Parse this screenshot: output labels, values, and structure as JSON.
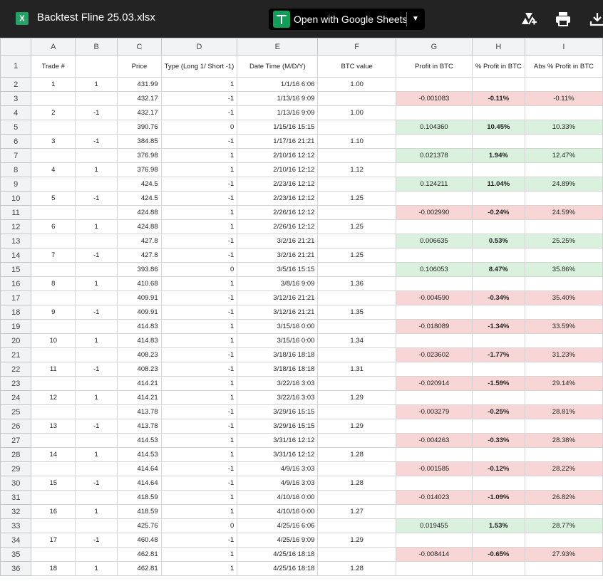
{
  "file": {
    "title": "Backtest Fline 25.03.xlsx",
    "icon_letter": "X"
  },
  "toolbar": {
    "open_label": "Open with Google Sheets",
    "icons": [
      "add-to-drive-icon",
      "print-icon",
      "download-icon"
    ]
  },
  "colors": {
    "positive": "#d9f1dd",
    "negative": "#f8d6d6",
    "topbar": "#232323"
  },
  "columns": [
    "A",
    "B",
    "C",
    "D",
    "E",
    "F",
    "G",
    "H",
    "I"
  ],
  "headers": {
    "trade": "Trade #",
    "b": "",
    "price": "Price",
    "type": "Type (Long 1/ Short -1)",
    "datetime": "Date Time (M/D/Y)",
    "btc_value": "BTC value",
    "profit_btc": "Profit in BTC",
    "pct_profit": "% Profit in BTC",
    "abs_pct": "Abs % Profit in BTC"
  },
  "rows": [
    {
      "n": "2",
      "a": "1",
      "b": "1",
      "c": "431.99",
      "d": "1",
      "e": "1/1/16 6:06",
      "f": "1.00",
      "g": "",
      "h": "",
      "i": "",
      "s": ""
    },
    {
      "n": "3",
      "a": "",
      "b": "",
      "c": "432.17",
      "d": "-1",
      "e": "1/13/16 9:09",
      "f": "",
      "g": "-0.001083",
      "h": "-0.11%",
      "i": "-0.11%",
      "s": "neg"
    },
    {
      "n": "4",
      "a": "2",
      "b": "-1",
      "c": "432.17",
      "d": "-1",
      "e": "1/13/16 9:09",
      "f": "1.00",
      "g": "",
      "h": "",
      "i": "",
      "s": ""
    },
    {
      "n": "5",
      "a": "",
      "b": "",
      "c": "390.76",
      "d": "0",
      "e": "1/15/16 15:15",
      "f": "",
      "g": "0.104360",
      "h": "10.45%",
      "i": "10.33%",
      "s": "pos"
    },
    {
      "n": "6",
      "a": "3",
      "b": "-1",
      "c": "384.85",
      "d": "-1",
      "e": "1/17/16 21:21",
      "f": "1.10",
      "g": "",
      "h": "",
      "i": "",
      "s": ""
    },
    {
      "n": "7",
      "a": "",
      "b": "",
      "c": "376.98",
      "d": "1",
      "e": "2/10/16 12:12",
      "f": "",
      "g": "0.021378",
      "h": "1.94%",
      "i": "12.47%",
      "s": "pos"
    },
    {
      "n": "8",
      "a": "4",
      "b": "1",
      "c": "376.98",
      "d": "1",
      "e": "2/10/16 12:12",
      "f": "1.12",
      "g": "",
      "h": "",
      "i": "",
      "s": ""
    },
    {
      "n": "9",
      "a": "",
      "b": "",
      "c": "424.5",
      "d": "-1",
      "e": "2/23/16 12:12",
      "f": "",
      "g": "0.124211",
      "h": "11.04%",
      "i": "24.89%",
      "s": "pos"
    },
    {
      "n": "10",
      "a": "5",
      "b": "-1",
      "c": "424.5",
      "d": "-1",
      "e": "2/23/16 12:12",
      "f": "1.25",
      "g": "",
      "h": "",
      "i": "",
      "s": ""
    },
    {
      "n": "11",
      "a": "",
      "b": "",
      "c": "424.88",
      "d": "1",
      "e": "2/26/16 12:12",
      "f": "",
      "g": "-0.002990",
      "h": "-0.24%",
      "i": "24.59%",
      "s": "neg"
    },
    {
      "n": "12",
      "a": "6",
      "b": "1",
      "c": "424.88",
      "d": "1",
      "e": "2/26/16 12:12",
      "f": "1.25",
      "g": "",
      "h": "",
      "i": "",
      "s": ""
    },
    {
      "n": "13",
      "a": "",
      "b": "",
      "c": "427.8",
      "d": "-1",
      "e": "3/2/16 21:21",
      "f": "",
      "g": "0.006635",
      "h": "0.53%",
      "i": "25.25%",
      "s": "pos"
    },
    {
      "n": "14",
      "a": "7",
      "b": "-1",
      "c": "427.8",
      "d": "-1",
      "e": "3/2/16 21:21",
      "f": "1.25",
      "g": "",
      "h": "",
      "i": "",
      "s": ""
    },
    {
      "n": "15",
      "a": "",
      "b": "",
      "c": "393.86",
      "d": "0",
      "e": "3/5/16 15:15",
      "f": "",
      "g": "0.106053",
      "h": "8.47%",
      "i": "35.86%",
      "s": "pos"
    },
    {
      "n": "16",
      "a": "8",
      "b": "1",
      "c": "410.68",
      "d": "1",
      "e": "3/8/16 9:09",
      "f": "1.36",
      "g": "",
      "h": "",
      "i": "",
      "s": ""
    },
    {
      "n": "17",
      "a": "",
      "b": "",
      "c": "409.91",
      "d": "-1",
      "e": "3/12/16 21:21",
      "f": "",
      "g": "-0.004590",
      "h": "-0.34%",
      "i": "35.40%",
      "s": "neg"
    },
    {
      "n": "18",
      "a": "9",
      "b": "-1",
      "c": "409.91",
      "d": "-1",
      "e": "3/12/16 21:21",
      "f": "1.35",
      "g": "",
      "h": "",
      "i": "",
      "s": ""
    },
    {
      "n": "19",
      "a": "",
      "b": "",
      "c": "414.83",
      "d": "1",
      "e": "3/15/16 0:00",
      "f": "",
      "g": "-0.018089",
      "h": "-1.34%",
      "i": "33.59%",
      "s": "neg"
    },
    {
      "n": "20",
      "a": "10",
      "b": "1",
      "c": "414.83",
      "d": "1",
      "e": "3/15/16 0:00",
      "f": "1.34",
      "g": "",
      "h": "",
      "i": "",
      "s": ""
    },
    {
      "n": "21",
      "a": "",
      "b": "",
      "c": "408.23",
      "d": "-1",
      "e": "3/18/16 18:18",
      "f": "",
      "g": "-0.023602",
      "h": "-1.77%",
      "i": "31.23%",
      "s": "neg"
    },
    {
      "n": "22",
      "a": "11",
      "b": "-1",
      "c": "408.23",
      "d": "-1",
      "e": "3/18/16 18:18",
      "f": "1.31",
      "g": "",
      "h": "",
      "i": "",
      "s": ""
    },
    {
      "n": "23",
      "a": "",
      "b": "",
      "c": "414.21",
      "d": "1",
      "e": "3/22/16 3:03",
      "f": "",
      "g": "-0.020914",
      "h": "-1.59%",
      "i": "29.14%",
      "s": "neg"
    },
    {
      "n": "24",
      "a": "12",
      "b": "1",
      "c": "414.21",
      "d": "1",
      "e": "3/22/16 3:03",
      "f": "1.29",
      "g": "",
      "h": "",
      "i": "",
      "s": ""
    },
    {
      "n": "25",
      "a": "",
      "b": "",
      "c": "413.78",
      "d": "-1",
      "e": "3/29/16 15:15",
      "f": "",
      "g": "-0.003279",
      "h": "-0.25%",
      "i": "28.81%",
      "s": "neg"
    },
    {
      "n": "26",
      "a": "13",
      "b": "-1",
      "c": "413.78",
      "d": "-1",
      "e": "3/29/16 15:15",
      "f": "1.29",
      "g": "",
      "h": "",
      "i": "",
      "s": ""
    },
    {
      "n": "27",
      "a": "",
      "b": "",
      "c": "414.53",
      "d": "1",
      "e": "3/31/16 12:12",
      "f": "",
      "g": "-0.004263",
      "h": "-0.33%",
      "i": "28.38%",
      "s": "neg"
    },
    {
      "n": "28",
      "a": "14",
      "b": "1",
      "c": "414.53",
      "d": "1",
      "e": "3/31/16 12:12",
      "f": "1.28",
      "g": "",
      "h": "",
      "i": "",
      "s": ""
    },
    {
      "n": "29",
      "a": "",
      "b": "",
      "c": "414.64",
      "d": "-1",
      "e": "4/9/16 3:03",
      "f": "",
      "g": "-0.001585",
      "h": "-0.12%",
      "i": "28.22%",
      "s": "neg"
    },
    {
      "n": "30",
      "a": "15",
      "b": "-1",
      "c": "414.64",
      "d": "-1",
      "e": "4/9/16 3:03",
      "f": "1.28",
      "g": "",
      "h": "",
      "i": "",
      "s": ""
    },
    {
      "n": "31",
      "a": "",
      "b": "",
      "c": "418.59",
      "d": "1",
      "e": "4/10/16 0:00",
      "f": "",
      "g": "-0.014023",
      "h": "-1.09%",
      "i": "26.82%",
      "s": "neg"
    },
    {
      "n": "32",
      "a": "16",
      "b": "1",
      "c": "418.59",
      "d": "1",
      "e": "4/10/16 0:00",
      "f": "1.27",
      "g": "",
      "h": "",
      "i": "",
      "s": ""
    },
    {
      "n": "33",
      "a": "",
      "b": "",
      "c": "425.76",
      "d": "0",
      "e": "4/25/16 6:06",
      "f": "",
      "g": "0.019455",
      "h": "1.53%",
      "i": "28.77%",
      "s": "pos"
    },
    {
      "n": "34",
      "a": "17",
      "b": "-1",
      "c": "460.48",
      "d": "-1",
      "e": "4/25/16 9:09",
      "f": "1.29",
      "g": "",
      "h": "",
      "i": "",
      "s": ""
    },
    {
      "n": "35",
      "a": "",
      "b": "",
      "c": "462.81",
      "d": "1",
      "e": "4/25/16 18:18",
      "f": "",
      "g": "-0.008414",
      "h": "-0.65%",
      "i": "27.93%",
      "s": "neg"
    },
    {
      "n": "36",
      "a": "18",
      "b": "1",
      "c": "462.81",
      "d": "1",
      "e": "4/25/16 18:18",
      "f": "1.28",
      "g": "",
      "h": "",
      "i": "",
      "s": ""
    }
  ]
}
